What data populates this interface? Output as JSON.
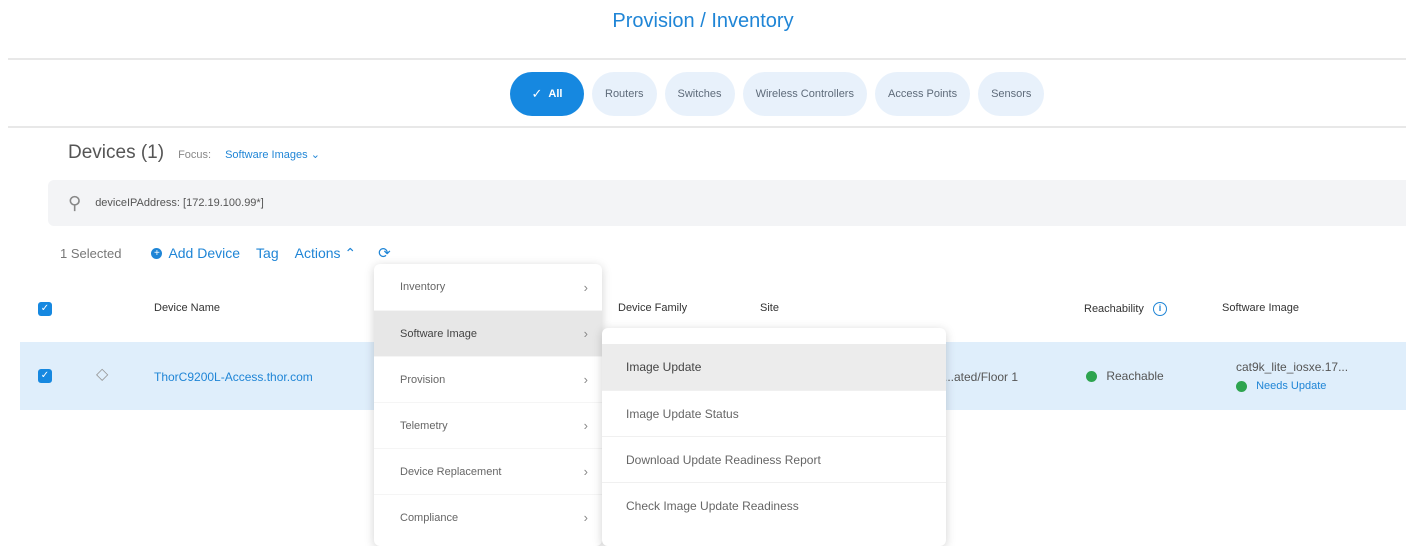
{
  "page": {
    "title": "Provision / Inventory"
  },
  "filters": [
    {
      "label": "All",
      "active": true
    },
    {
      "label": "Routers",
      "active": false
    },
    {
      "label": "Switches",
      "active": false
    },
    {
      "label": "Wireless Controllers",
      "active": false
    },
    {
      "label": "Access Points",
      "active": false
    },
    {
      "label": "Sensors",
      "active": false
    }
  ],
  "devices": {
    "title": "Devices (1)",
    "focus_label": "Focus:",
    "focus_value": "Software Images"
  },
  "search": {
    "value": "deviceIPAddress: [172.19.100.99*]",
    "icon": "search-icon"
  },
  "action_bar": {
    "selected_text": "1 Selected",
    "add_device_label": "Add Device",
    "tag_label": "Tag",
    "actions_label": "Actions",
    "refresh_icon": "refresh-icon"
  },
  "table": {
    "columns": {
      "device_name": "Device Name",
      "device_family": "Device Family",
      "site": "Site",
      "reachability": "Reachability",
      "software_image": "Software Image"
    },
    "rows": [
      {
        "device_name": "ThorC9200L-Access.thor.com",
        "site": "...ated/Floor 1",
        "reachability": "Reachable",
        "software_image": "cat9k_lite_iosxe.17...",
        "image_status": "Needs Update",
        "status_color": "#2ea44f"
      }
    ]
  },
  "actions_menu": [
    {
      "label": "Inventory",
      "active": false
    },
    {
      "label": "Software Image",
      "active": true
    },
    {
      "label": "Provision",
      "active": false
    },
    {
      "label": "Telemetry",
      "active": false
    },
    {
      "label": "Device Replacement",
      "active": false
    },
    {
      "label": "Compliance",
      "active": false
    }
  ],
  "software_image_submenu": [
    {
      "label": "Image Update",
      "active": true
    },
    {
      "label": "Image Update Status",
      "active": false
    },
    {
      "label": "Download Update Readiness Report",
      "active": false
    },
    {
      "label": "Check Image Update Readiness",
      "active": false
    }
  ],
  "colors": {
    "accent": "#1f85d6",
    "active_pill": "#1688e0",
    "row_highlight": "#dfeefb",
    "reachable": "#2ea44f"
  }
}
